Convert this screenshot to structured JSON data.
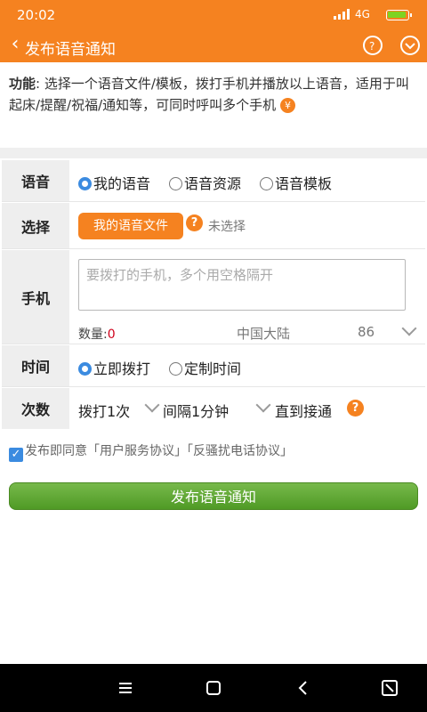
{
  "status": {
    "time": "20:02",
    "network": "4G"
  },
  "appbar": {
    "title": "发布语音通知"
  },
  "intro": {
    "label": "功能",
    "text": ": 选择一个语音文件/模板，拨打手机并播放以上语音，适用于叫起床/提醒/祝福/通知等，可同时呼叫多个手机",
    "coin": "¥"
  },
  "voice": {
    "label": "语音",
    "options": [
      "我的语音",
      "语音资源",
      "语音模板"
    ]
  },
  "select": {
    "label": "选择",
    "button": "我的语音文件",
    "help": "?",
    "status": "未选择"
  },
  "phone": {
    "label": "手机",
    "placeholder": "要拨打的手机，多个用空格隔开",
    "count_label": "数量:",
    "count_value": "0",
    "region": "中国大陆",
    "code": "86"
  },
  "time": {
    "label": "时间",
    "options": [
      "立即拨打",
      "定制时间"
    ]
  },
  "times": {
    "label": "次数",
    "count": "拨打1次",
    "interval": "间隔1分钟",
    "until": "直到接通",
    "help": "?"
  },
  "agreement": {
    "prefix": "发布即同意",
    "link1": "「用户服务协议」",
    "link2": "「反骚扰电话协议」"
  },
  "submit": {
    "label": "发布语音通知"
  },
  "colors": {
    "brand": "#f58220",
    "accent": "#3b8be0",
    "button": "#5ea832"
  }
}
